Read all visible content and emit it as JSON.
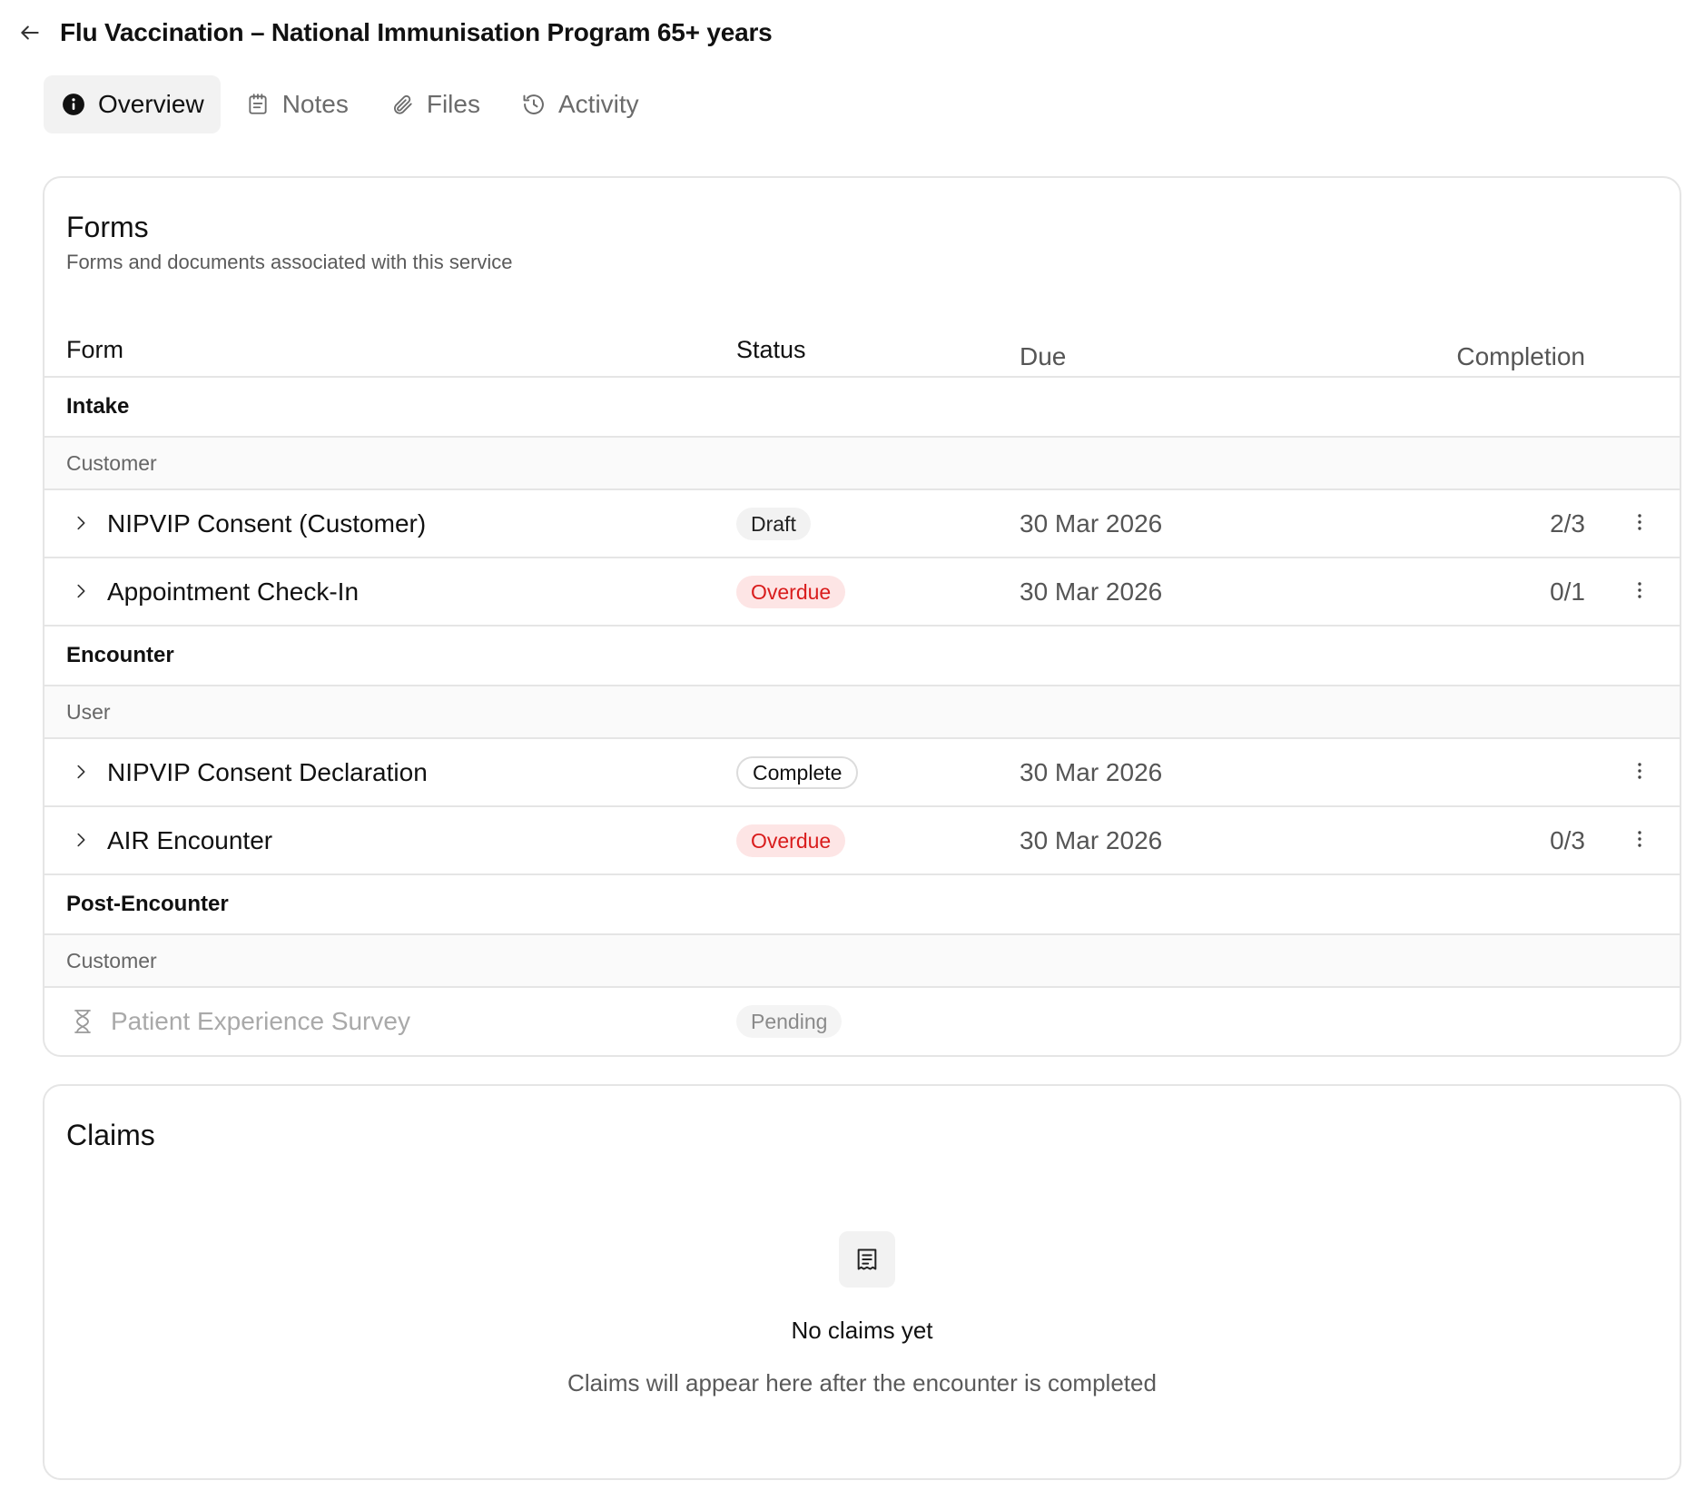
{
  "header": {
    "title": "Flu Vaccination – National Immunisation Program 65+ years"
  },
  "tabs": [
    {
      "label": "Overview",
      "icon": "info-icon",
      "active": true
    },
    {
      "label": "Notes",
      "icon": "notepad-icon",
      "active": false
    },
    {
      "label": "Files",
      "icon": "paperclip-icon",
      "active": false
    },
    {
      "label": "Activity",
      "icon": "history-icon",
      "active": false
    }
  ],
  "forms": {
    "title": "Forms",
    "subtitle": "Forms and documents associated with this service",
    "columns": {
      "form": "Form",
      "status": "Status",
      "due": "Due",
      "completion": "Completion"
    },
    "groups": [
      {
        "name": "Intake",
        "subgroup": "Customer",
        "rows": [
          {
            "name": "NIPVIP Consent (Customer)",
            "status": "Draft",
            "due": "30 Mar 2026",
            "completion": "2/3"
          },
          {
            "name": "Appointment Check-In",
            "status": "Overdue",
            "due": "30 Mar 2026",
            "completion": "0/1"
          }
        ]
      },
      {
        "name": "Encounter",
        "subgroup": "User",
        "rows": [
          {
            "name": "NIPVIP Consent Declaration",
            "status": "Complete",
            "due": "30 Mar 2026",
            "completion": ""
          },
          {
            "name": "AIR Encounter",
            "status": "Overdue",
            "due": "30 Mar 2026",
            "completion": "0/3"
          }
        ]
      },
      {
        "name": "Post-Encounter",
        "subgroup": "Customer",
        "rows": [
          {
            "name": "Patient Experience Survey",
            "status": "Pending",
            "due": "",
            "completion": ""
          }
        ]
      }
    ]
  },
  "claims": {
    "title": "Claims",
    "empty_icon": "receipt-icon",
    "empty_title": "No claims yet",
    "empty_description": "Claims will appear here after the encounter is completed"
  },
  "colors": {
    "overdue_text": "#d91c1c",
    "overdue_bg": "#fde5e5",
    "border": "#e5e5e5",
    "active_tab_bg": "#f2f2f2"
  }
}
